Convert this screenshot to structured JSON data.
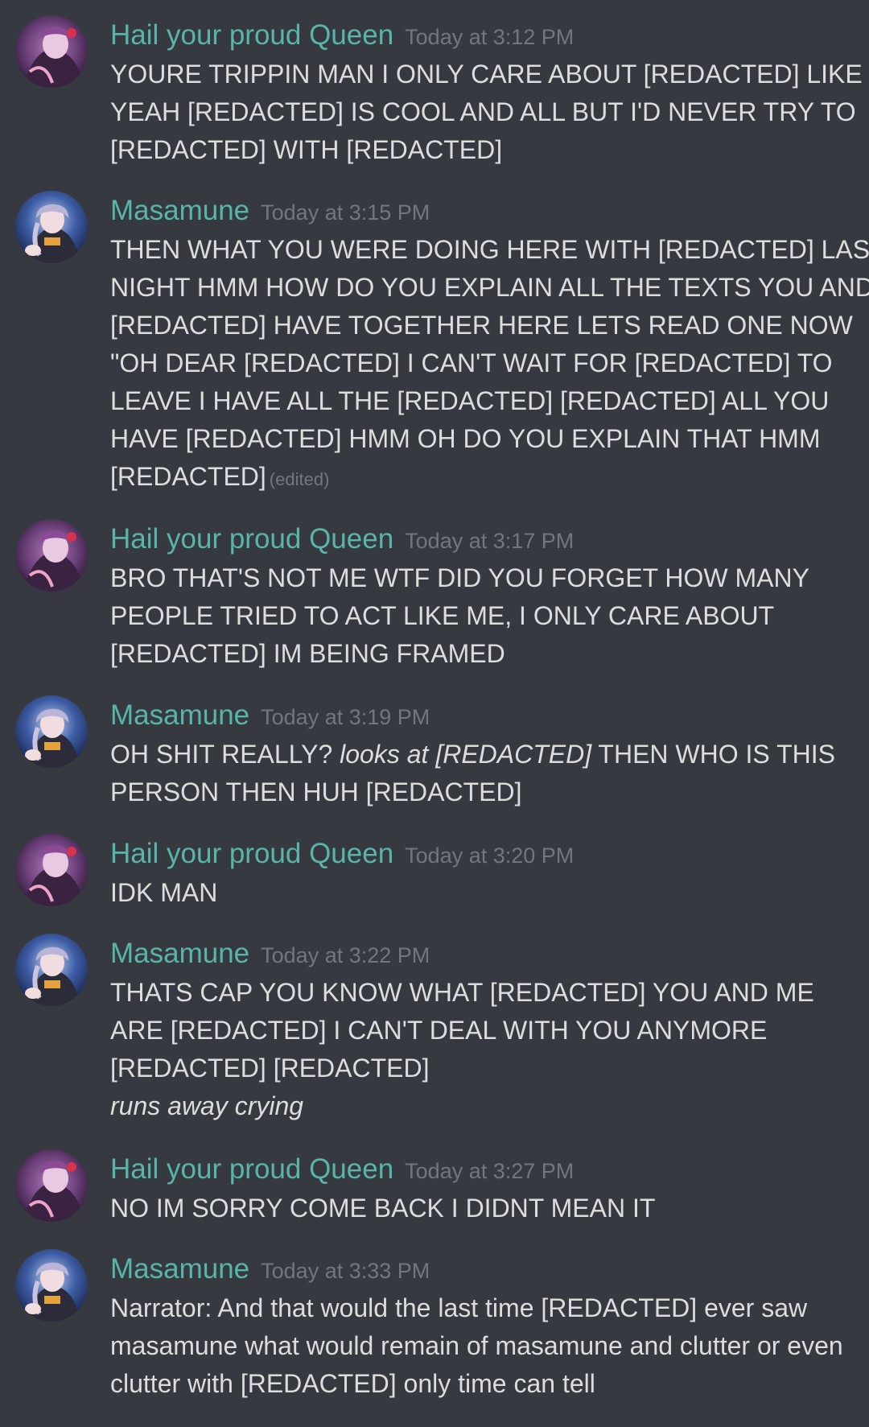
{
  "users": {
    "queen": {
      "name": "Hail your proud Queen",
      "avatar_icon": "queen-avatar-icon"
    },
    "masamune": {
      "name": "Masamune",
      "avatar_icon": "masamune-avatar-icon"
    }
  },
  "colors": {
    "background": "#36393f",
    "username": "#58b5a8",
    "timestamp": "#72767d",
    "text": "#dcddde"
  },
  "messages": [
    {
      "author": "Hail your proud Queen",
      "time": "Today at 3:12 PM",
      "lines": [
        "YOURE TRIPPIN MAN I ONLY CARE ABOUT [REDACTED] LIKE",
        "YEAH [REDACTED] IS COOL AND ALL BUT I'D NEVER TRY TO",
        "[REDACTED] WITH [REDACTED]"
      ]
    },
    {
      "author": "Masamune",
      "time": "Today at 3:15 PM",
      "lines": [
        "THEN WHAT YOU WERE DOING HERE WITH [REDACTED] LAST",
        "NIGHT HMM HOW DO YOU EXPLAIN ALL THE TEXTS YOU AND",
        "[REDACTED] HAVE TOGETHER HERE LETS READ ONE NOW",
        "\"OH DEAR [REDACTED] I CAN'T WAIT FOR [REDACTED] TO",
        "LEAVE I HAVE ALL THE [REDACTED] [REDACTED] ALL YOU",
        "HAVE [REDACTED] HMM OH DO YOU EXPLAIN THAT HMM",
        "[REDACTED]"
      ],
      "edited": "(edited)"
    },
    {
      "author": "Hail your proud Queen",
      "time": "Today at 3:17 PM",
      "lines": [
        "BRO THAT'S NOT ME WTF DID YOU FORGET HOW MANY",
        "PEOPLE TRIED TO ACT LIKE ME, I ONLY CARE ABOUT",
        "[REDACTED] IM BEING FRAMED"
      ]
    },
    {
      "author": "Masamune",
      "time": "Today at 3:19 PM",
      "line1_pre": "OH SHIT REALLY? ",
      "line1_italic": "looks at [REDACTED]",
      "line1_post": " THEN WHO IS THIS",
      "line2": "PERSON THEN HUH [REDACTED]"
    },
    {
      "author": "Hail your proud Queen",
      "time": "Today at 3:20 PM",
      "lines": [
        "IDK MAN"
      ]
    },
    {
      "author": "Masamune",
      "time": "Today at 3:22 PM",
      "lines": [
        "THATS CAP YOU KNOW WHAT [REDACTED] YOU AND ME",
        "ARE [REDACTED] I CAN'T DEAL WITH YOU ANYMORE",
        "[REDACTED] [REDACTED]"
      ],
      "italic_line": "runs away crying"
    },
    {
      "author": "Hail your proud Queen",
      "time": "Today at 3:27 PM",
      "lines": [
        "NO IM SORRY COME BACK I DIDNT MEAN IT"
      ]
    },
    {
      "author": "Masamune",
      "time": "Today at 3:33 PM",
      "lines": [
        "Narrator: And that would the last time [REDACTED] ever saw",
        "masamune what would remain of masamune and clutter or even",
        "clutter with [REDACTED] only time can tell"
      ]
    }
  ]
}
